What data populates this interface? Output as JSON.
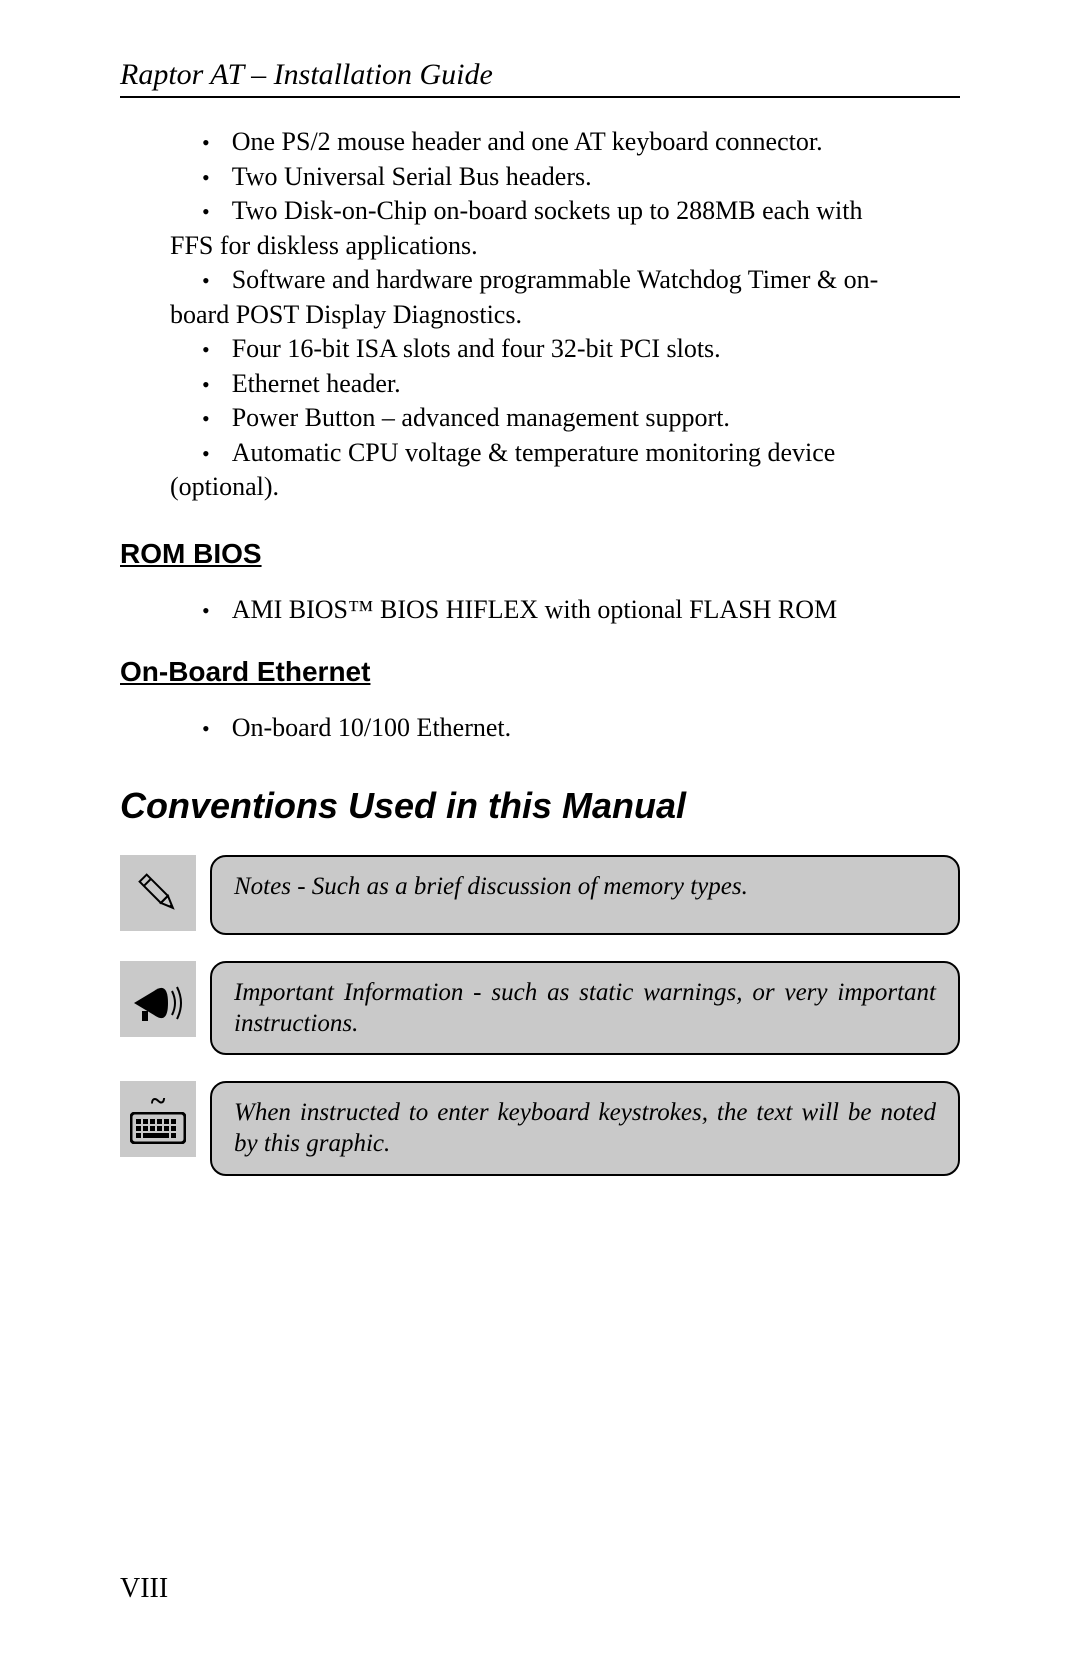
{
  "header": {
    "title": "Raptor AT – Installation Guide"
  },
  "features": {
    "b1": "One PS/2 mouse header and one AT keyboard connector.",
    "b2": "Two Universal Serial Bus headers.",
    "b3a": "Two Disk-on-Chip on-board sockets up to 288MB each with",
    "b3b": "FFS for diskless applications.",
    "b4a": "Software and hardware programmable Watchdog Timer & on-",
    "b4b": "board POST Display Diagnostics.",
    "b5": "Four 16-bit ISA slots and four 32-bit PCI slots.",
    "b6": "Ethernet header.",
    "b7": "Power Button – advanced management support.",
    "b8a": "Automatic  CPU  voltage  &  temperature  monitoring  device",
    "b8b": "(optional)."
  },
  "sections": {
    "rom_bios": "ROM BIOS",
    "rom_bios_item": "AMI BIOS™ BIOS HIFLEX with optional FLASH ROM",
    "ethernet": "On-Board Ethernet",
    "ethernet_item": "On-board 10/100 Ethernet.",
    "conventions": "Conventions Used in this Manual"
  },
  "conventions": {
    "note": "Notes - Such as a brief discussion of memory types.",
    "important": "Important Information - such as static warnings, or very important instructions.",
    "keyboard": "When instructed to enter keyboard keystrokes, the text will be noted by this graphic."
  },
  "page_number": "VIII"
}
